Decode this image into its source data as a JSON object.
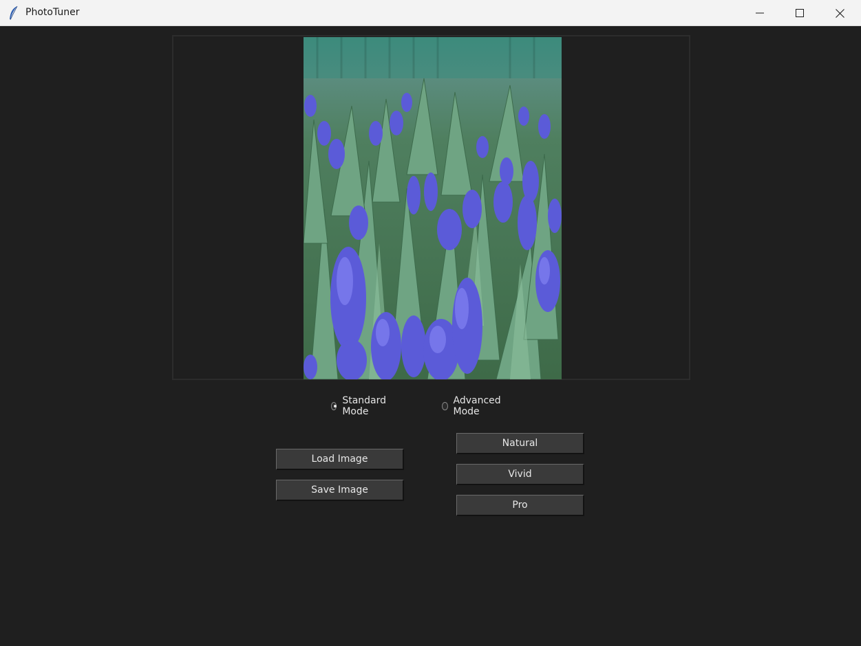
{
  "window": {
    "title": "PhotoTuner",
    "controls": {
      "minimize_icon": "minimize-icon",
      "maximize_icon": "maximize-icon",
      "close_icon": "close-icon"
    }
  },
  "mode": {
    "options": [
      {
        "label": "Standard Mode",
        "selected": true
      },
      {
        "label": "Advanced Mode",
        "selected": false
      }
    ]
  },
  "file_buttons": {
    "load_label": "Load Image",
    "save_label": "Save Image"
  },
  "preset_buttons": {
    "natural_label": "Natural",
    "vivid_label": "Vivid",
    "pro_label": "Pro"
  },
  "colors": {
    "background": "#1f1f1f",
    "button": "#3a3a3a",
    "text": "#e8e8e8"
  }
}
